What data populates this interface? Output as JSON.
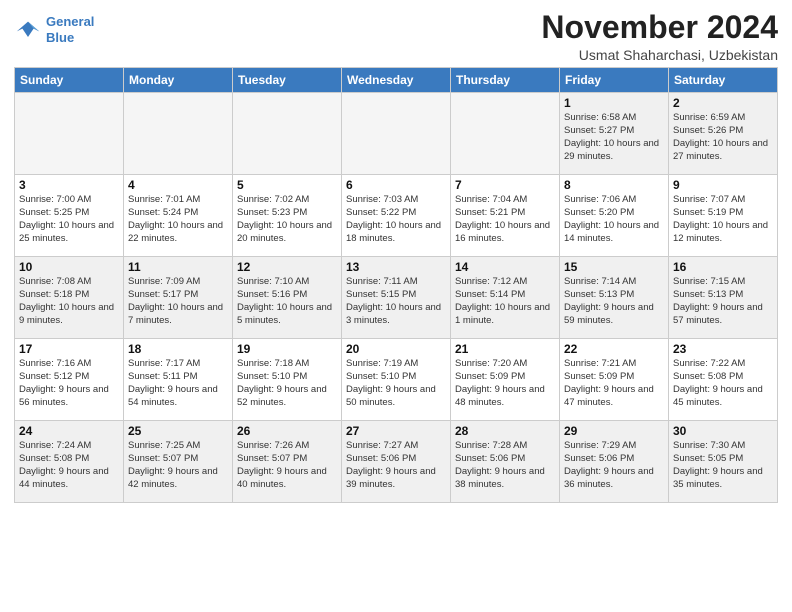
{
  "header": {
    "logo_line1": "General",
    "logo_line2": "Blue",
    "month": "November 2024",
    "location": "Usmat Shaharchasi, Uzbekistan"
  },
  "days_of_week": [
    "Sunday",
    "Monday",
    "Tuesday",
    "Wednesday",
    "Thursday",
    "Friday",
    "Saturday"
  ],
  "weeks": [
    [
      {
        "day": "",
        "info": "",
        "empty": true
      },
      {
        "day": "",
        "info": "",
        "empty": true
      },
      {
        "day": "",
        "info": "",
        "empty": true
      },
      {
        "day": "",
        "info": "",
        "empty": true
      },
      {
        "day": "",
        "info": "",
        "empty": true
      },
      {
        "day": "1",
        "info": "Sunrise: 6:58 AM\nSunset: 5:27 PM\nDaylight: 10 hours\nand 29 minutes."
      },
      {
        "day": "2",
        "info": "Sunrise: 6:59 AM\nSunset: 5:26 PM\nDaylight: 10 hours\nand 27 minutes."
      }
    ],
    [
      {
        "day": "3",
        "info": "Sunrise: 7:00 AM\nSunset: 5:25 PM\nDaylight: 10 hours\nand 25 minutes."
      },
      {
        "day": "4",
        "info": "Sunrise: 7:01 AM\nSunset: 5:24 PM\nDaylight: 10 hours\nand 22 minutes."
      },
      {
        "day": "5",
        "info": "Sunrise: 7:02 AM\nSunset: 5:23 PM\nDaylight: 10 hours\nand 20 minutes."
      },
      {
        "day": "6",
        "info": "Sunrise: 7:03 AM\nSunset: 5:22 PM\nDaylight: 10 hours\nand 18 minutes."
      },
      {
        "day": "7",
        "info": "Sunrise: 7:04 AM\nSunset: 5:21 PM\nDaylight: 10 hours\nand 16 minutes."
      },
      {
        "day": "8",
        "info": "Sunrise: 7:06 AM\nSunset: 5:20 PM\nDaylight: 10 hours\nand 14 minutes."
      },
      {
        "day": "9",
        "info": "Sunrise: 7:07 AM\nSunset: 5:19 PM\nDaylight: 10 hours\nand 12 minutes."
      }
    ],
    [
      {
        "day": "10",
        "info": "Sunrise: 7:08 AM\nSunset: 5:18 PM\nDaylight: 10 hours\nand 9 minutes."
      },
      {
        "day": "11",
        "info": "Sunrise: 7:09 AM\nSunset: 5:17 PM\nDaylight: 10 hours\nand 7 minutes."
      },
      {
        "day": "12",
        "info": "Sunrise: 7:10 AM\nSunset: 5:16 PM\nDaylight: 10 hours\nand 5 minutes."
      },
      {
        "day": "13",
        "info": "Sunrise: 7:11 AM\nSunset: 5:15 PM\nDaylight: 10 hours\nand 3 minutes."
      },
      {
        "day": "14",
        "info": "Sunrise: 7:12 AM\nSunset: 5:14 PM\nDaylight: 10 hours\nand 1 minute."
      },
      {
        "day": "15",
        "info": "Sunrise: 7:14 AM\nSunset: 5:13 PM\nDaylight: 9 hours\nand 59 minutes."
      },
      {
        "day": "16",
        "info": "Sunrise: 7:15 AM\nSunset: 5:13 PM\nDaylight: 9 hours\nand 57 minutes."
      }
    ],
    [
      {
        "day": "17",
        "info": "Sunrise: 7:16 AM\nSunset: 5:12 PM\nDaylight: 9 hours\nand 56 minutes."
      },
      {
        "day": "18",
        "info": "Sunrise: 7:17 AM\nSunset: 5:11 PM\nDaylight: 9 hours\nand 54 minutes."
      },
      {
        "day": "19",
        "info": "Sunrise: 7:18 AM\nSunset: 5:10 PM\nDaylight: 9 hours\nand 52 minutes."
      },
      {
        "day": "20",
        "info": "Sunrise: 7:19 AM\nSunset: 5:10 PM\nDaylight: 9 hours\nand 50 minutes."
      },
      {
        "day": "21",
        "info": "Sunrise: 7:20 AM\nSunset: 5:09 PM\nDaylight: 9 hours\nand 48 minutes."
      },
      {
        "day": "22",
        "info": "Sunrise: 7:21 AM\nSunset: 5:09 PM\nDaylight: 9 hours\nand 47 minutes."
      },
      {
        "day": "23",
        "info": "Sunrise: 7:22 AM\nSunset: 5:08 PM\nDaylight: 9 hours\nand 45 minutes."
      }
    ],
    [
      {
        "day": "24",
        "info": "Sunrise: 7:24 AM\nSunset: 5:08 PM\nDaylight: 9 hours\nand 44 minutes."
      },
      {
        "day": "25",
        "info": "Sunrise: 7:25 AM\nSunset: 5:07 PM\nDaylight: 9 hours\nand 42 minutes."
      },
      {
        "day": "26",
        "info": "Sunrise: 7:26 AM\nSunset: 5:07 PM\nDaylight: 9 hours\nand 40 minutes."
      },
      {
        "day": "27",
        "info": "Sunrise: 7:27 AM\nSunset: 5:06 PM\nDaylight: 9 hours\nand 39 minutes."
      },
      {
        "day": "28",
        "info": "Sunrise: 7:28 AM\nSunset: 5:06 PM\nDaylight: 9 hours\nand 38 minutes."
      },
      {
        "day": "29",
        "info": "Sunrise: 7:29 AM\nSunset: 5:06 PM\nDaylight: 9 hours\nand 36 minutes."
      },
      {
        "day": "30",
        "info": "Sunrise: 7:30 AM\nSunset: 5:05 PM\nDaylight: 9 hours\nand 35 minutes."
      }
    ]
  ]
}
